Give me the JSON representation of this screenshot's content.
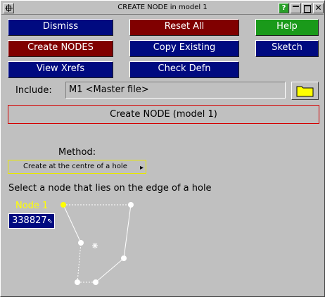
{
  "window": {
    "title": "CREATE NODE in model 1",
    "help_glyph": "?",
    "close_glyph": "✕"
  },
  "buttons": {
    "dismiss": "Dismiss",
    "reset_all": "Reset All",
    "help": "Help",
    "create_nodes": "Create NODES",
    "copy_existing": "Copy Existing",
    "sketch": "Sketch",
    "view_xrefs": "View Xrefs",
    "check_defn": "Check Defn"
  },
  "include": {
    "label": "Include:",
    "value": "M1  <Master file>"
  },
  "panel": {
    "header": "Create NODE (model 1)"
  },
  "method": {
    "label": "Method:",
    "selected": "Create at the centre of a hole"
  },
  "instruction": "Select a node that lies on the edge of a hole",
  "node": {
    "label": "Node 1",
    "value": "338827"
  },
  "colors": {
    "background": "#c0c0c0",
    "button_blue": "#000a80",
    "button_red": "#800000",
    "button_green": "#1a9a1a",
    "highlight_yellow": "#ffff00",
    "header_border": "#d40000"
  }
}
